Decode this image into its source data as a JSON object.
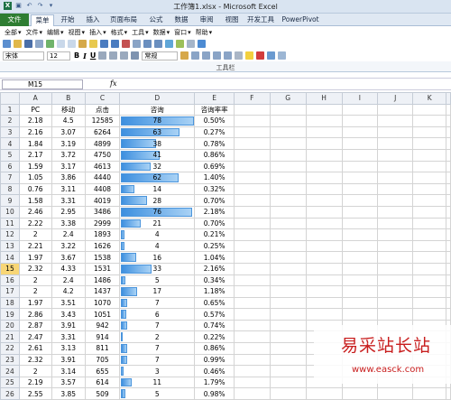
{
  "window": {
    "title": "工作簿1.xlsx - Microsoft Excel"
  },
  "ribbon": {
    "tabs": [
      "文件",
      "菜单",
      "开始",
      "插入",
      "页面布局",
      "公式",
      "数据",
      "审阅",
      "视图",
      "开发工具",
      "PowerPivot"
    ],
    "active_tab": "菜单",
    "menus": [
      "全部",
      "文件",
      "编辑",
      "视图",
      "插入",
      "格式",
      "工具",
      "数据",
      "窗口",
      "帮助"
    ],
    "font_name": "宋体",
    "font_size": "12",
    "number_format": "常规",
    "group_label": "工具栏"
  },
  "formula_bar": {
    "name_box": "M15",
    "fx": "fx",
    "value": ""
  },
  "columns": [
    "A",
    "B",
    "C",
    "D",
    "E",
    "F",
    "G",
    "H",
    "I",
    "J",
    "K"
  ],
  "selected_row": 15,
  "headers": [
    "PC",
    "移动",
    "点击",
    "咨询",
    "咨询率率"
  ],
  "rows": [
    [
      "2.18",
      "4.5",
      "12585",
      78,
      "0.50%"
    ],
    [
      "2.16",
      "3.07",
      "6264",
      63,
      "0.27%"
    ],
    [
      "1.84",
      "3.19",
      "4899",
      38,
      "0.78%"
    ],
    [
      "2.17",
      "3.72",
      "4750",
      41,
      "0.86%"
    ],
    [
      "1.59",
      "3.17",
      "4613",
      32,
      "0.69%"
    ],
    [
      "1.05",
      "3.86",
      "4440",
      62,
      "1.40%"
    ],
    [
      "0.76",
      "3.11",
      "4408",
      14,
      "0.32%"
    ],
    [
      "1.58",
      "3.31",
      "4019",
      28,
      "0.70%"
    ],
    [
      "2.46",
      "2.95",
      "3486",
      76,
      "2.18%"
    ],
    [
      "2.22",
      "3.38",
      "2999",
      21,
      "0.70%"
    ],
    [
      "2",
      "2.4",
      "1893",
      4,
      "0.21%"
    ],
    [
      "2.21",
      "3.22",
      "1626",
      4,
      "0.25%"
    ],
    [
      "1.97",
      "3.67",
      "1538",
      16,
      "1.04%"
    ],
    [
      "2.32",
      "4.33",
      "1531",
      33,
      "2.16%"
    ],
    [
      "2",
      "2.4",
      "1486",
      5,
      "0.34%"
    ],
    [
      "2",
      "4.2",
      "1437",
      17,
      "1.18%"
    ],
    [
      "1.97",
      "3.51",
      "1070",
      7,
      "0.65%"
    ],
    [
      "2.86",
      "3.43",
      "1051",
      6,
      "0.57%"
    ],
    [
      "2.87",
      "3.91",
      "942",
      7,
      "0.74%"
    ],
    [
      "2.47",
      "3.31",
      "914",
      2,
      "0.22%"
    ],
    [
      "2.61",
      "3.13",
      "811",
      7,
      "0.86%"
    ],
    [
      "2.32",
      "3.91",
      "705",
      7,
      "0.99%"
    ],
    [
      "2",
      "3.14",
      "655",
      3,
      "0.46%"
    ],
    [
      "2.19",
      "3.57",
      "614",
      11,
      "1.79%"
    ],
    [
      "2.55",
      "3.85",
      "509",
      5,
      "0.98%"
    ]
  ],
  "databar_max": 78,
  "watermark": {
    "cn": "易采站长站",
    "url": "www.easck.com"
  }
}
